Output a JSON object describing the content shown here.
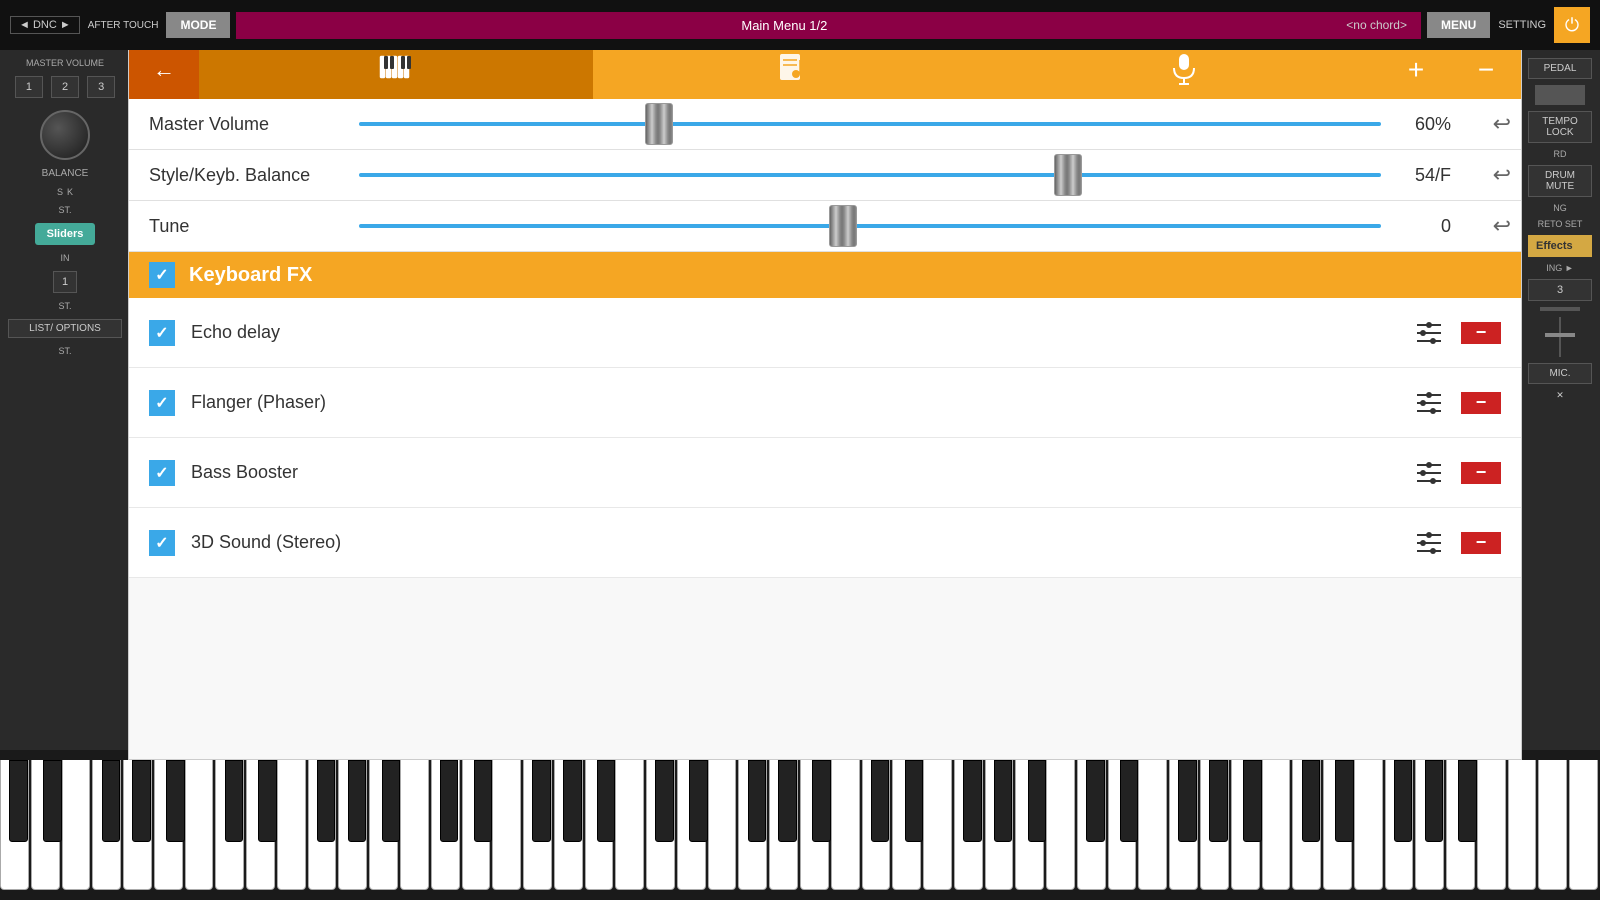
{
  "topBar": {
    "dnc_label": "◄ DNC ►",
    "aftertouch_label": "AFTER TOUCH",
    "mode_label": "MODE",
    "main_menu_label": "Main Menu  1/2",
    "no_chord_label": "<no chord>",
    "menu_label": "MENU",
    "setting_label": "SETTING",
    "power_icon": "⏻"
  },
  "leftPanel": {
    "master_volume_label": "MASTER VOLUME",
    "balance_label": "BALANCE",
    "sliders_label": "Sliders",
    "list_options_label": "LIST/ OPTIONS"
  },
  "rightPanel": {
    "pedal_label": "PEDAL",
    "tempo_lock_label": "TEMPO LOCK",
    "drum_mute_label": "DRUM MUTE",
    "effects_label": "Effects",
    "mic_label": "MIC."
  },
  "header": {
    "back_icon": "←",
    "piano_icon": "🎹",
    "song_icon": "🎵",
    "mic_icon": "🎤",
    "plus_icon": "+",
    "minus_icon": "−"
  },
  "sliders": [
    {
      "label": "Master Volume",
      "value": "60%",
      "thumb_pct": 30
    },
    {
      "label": "Style/Keyb. Balance",
      "value": "54/F",
      "thumb_pct": 72
    },
    {
      "label": "Tune",
      "value": "0",
      "thumb_pct": 50
    }
  ],
  "keyboardFX": {
    "section_label": "Keyboard FX",
    "checked": true,
    "effects": [
      {
        "label": "Echo delay",
        "checked": true
      },
      {
        "label": "Flanger (Phaser)",
        "checked": true
      },
      {
        "label": "Bass Booster",
        "checked": true
      },
      {
        "label": "3D Sound (Stereo)",
        "checked": true
      }
    ]
  },
  "checkmark": "✓"
}
